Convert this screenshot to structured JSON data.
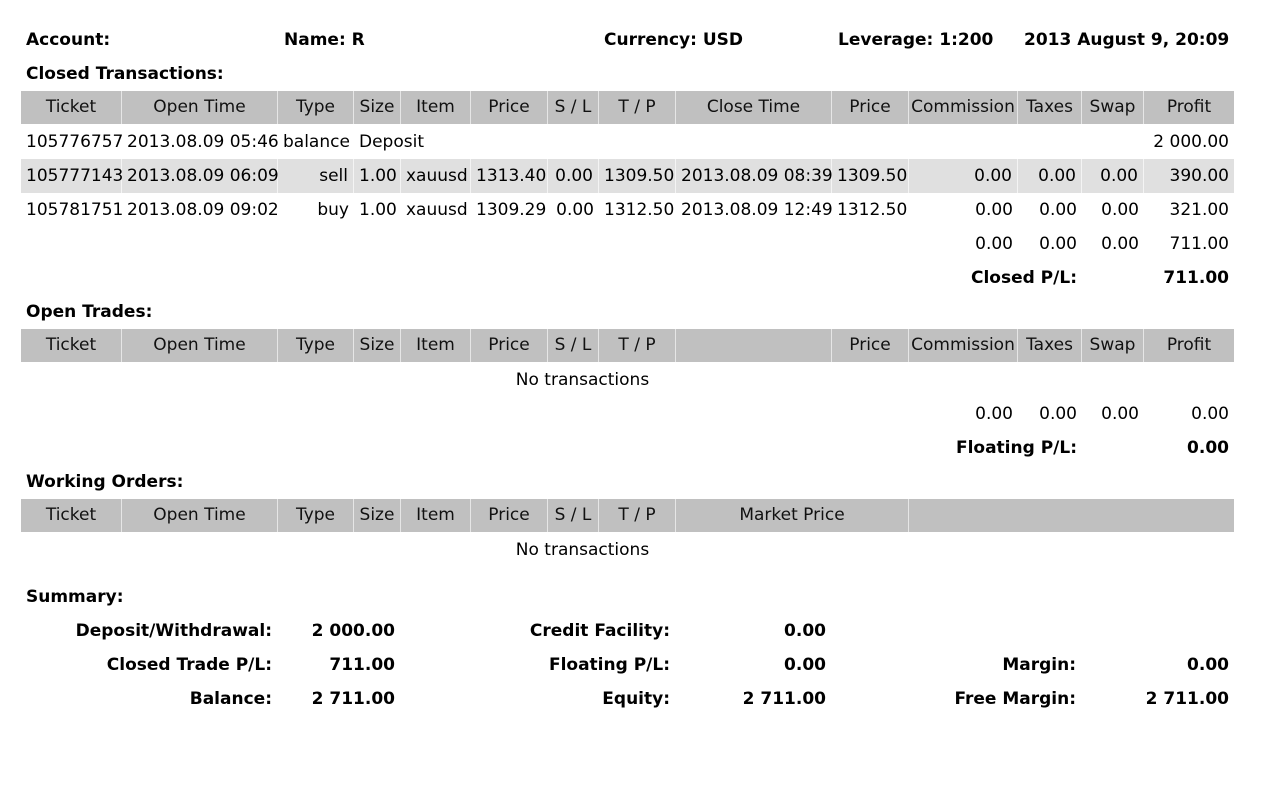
{
  "header": {
    "account_label": "Account:",
    "name_label": "Name: R",
    "currency_label": "Currency: USD",
    "leverage_label": "Leverage: 1:200",
    "datetime": "2013 August 9, 20:09"
  },
  "closed": {
    "title": "Closed Transactions:",
    "columns": [
      "Ticket",
      "Open Time",
      "Type",
      "Size",
      "Item",
      "Price",
      "S / L",
      "T / P",
      "Close Time",
      "Price",
      "Commission",
      "Taxes",
      "Swap",
      "Profit"
    ],
    "rows": [
      {
        "ticket": "105776757",
        "open_time": "2013.08.09 05:46",
        "type": "balance",
        "item": "Deposit",
        "profit": "2 000.00"
      },
      {
        "ticket": "105777143",
        "open_time": "2013.08.09 06:09",
        "type": "sell",
        "size": "1.00",
        "item": "xauusd",
        "price": "1313.40",
        "sl": "0.00",
        "tp": "1309.50",
        "close_time": "2013.08.09 08:39",
        "close_price": "1309.50",
        "commission": "0.00",
        "taxes": "0.00",
        "swap": "0.00",
        "profit": "390.00"
      },
      {
        "ticket": "105781751",
        "open_time": "2013.08.09 09:02",
        "type": "buy",
        "size": "1.00",
        "item": "xauusd",
        "price": "1309.29",
        "sl": "0.00",
        "tp": "1312.50",
        "close_time": "2013.08.09 12:49",
        "close_price": "1312.50",
        "commission": "0.00",
        "taxes": "0.00",
        "swap": "0.00",
        "profit": "321.00"
      }
    ],
    "totals": {
      "commission": "0.00",
      "taxes": "0.00",
      "swap": "0.00",
      "profit": "711.00"
    },
    "pl_label": "Closed P/L:",
    "pl_value": "711.00"
  },
  "open": {
    "title": "Open Trades:",
    "columns": [
      "Ticket",
      "Open Time",
      "Type",
      "Size",
      "Item",
      "Price",
      "S / L",
      "T / P",
      "",
      "Price",
      "Commission",
      "Taxes",
      "Swap",
      "Profit"
    ],
    "empty_text": "No transactions",
    "totals": {
      "commission": "0.00",
      "taxes": "0.00",
      "swap": "0.00",
      "profit": "0.00"
    },
    "pl_label": "Floating P/L:",
    "pl_value": "0.00"
  },
  "working": {
    "title": "Working Orders:",
    "columns": [
      "Ticket",
      "Open Time",
      "Type",
      "Size",
      "Item",
      "Price",
      "S / L",
      "T / P",
      "Market Price",
      ""
    ],
    "empty_text": "No transactions"
  },
  "summary": {
    "title": "Summary:",
    "deposit_label": "Deposit/Withdrawal:",
    "deposit_value": "2 000.00",
    "closed_pl_label": "Closed Trade P/L:",
    "closed_pl_value": "711.00",
    "balance_label": "Balance:",
    "balance_value": "2 711.00",
    "credit_label": "Credit Facility:",
    "credit_value": "0.00",
    "floating_label": "Floating P/L:",
    "floating_value": "0.00",
    "equity_label": "Equity:",
    "equity_value": "2 711.00",
    "margin_label": "Margin:",
    "margin_value": "0.00",
    "free_margin_label": "Free Margin:",
    "free_margin_value": "2 711.00"
  }
}
